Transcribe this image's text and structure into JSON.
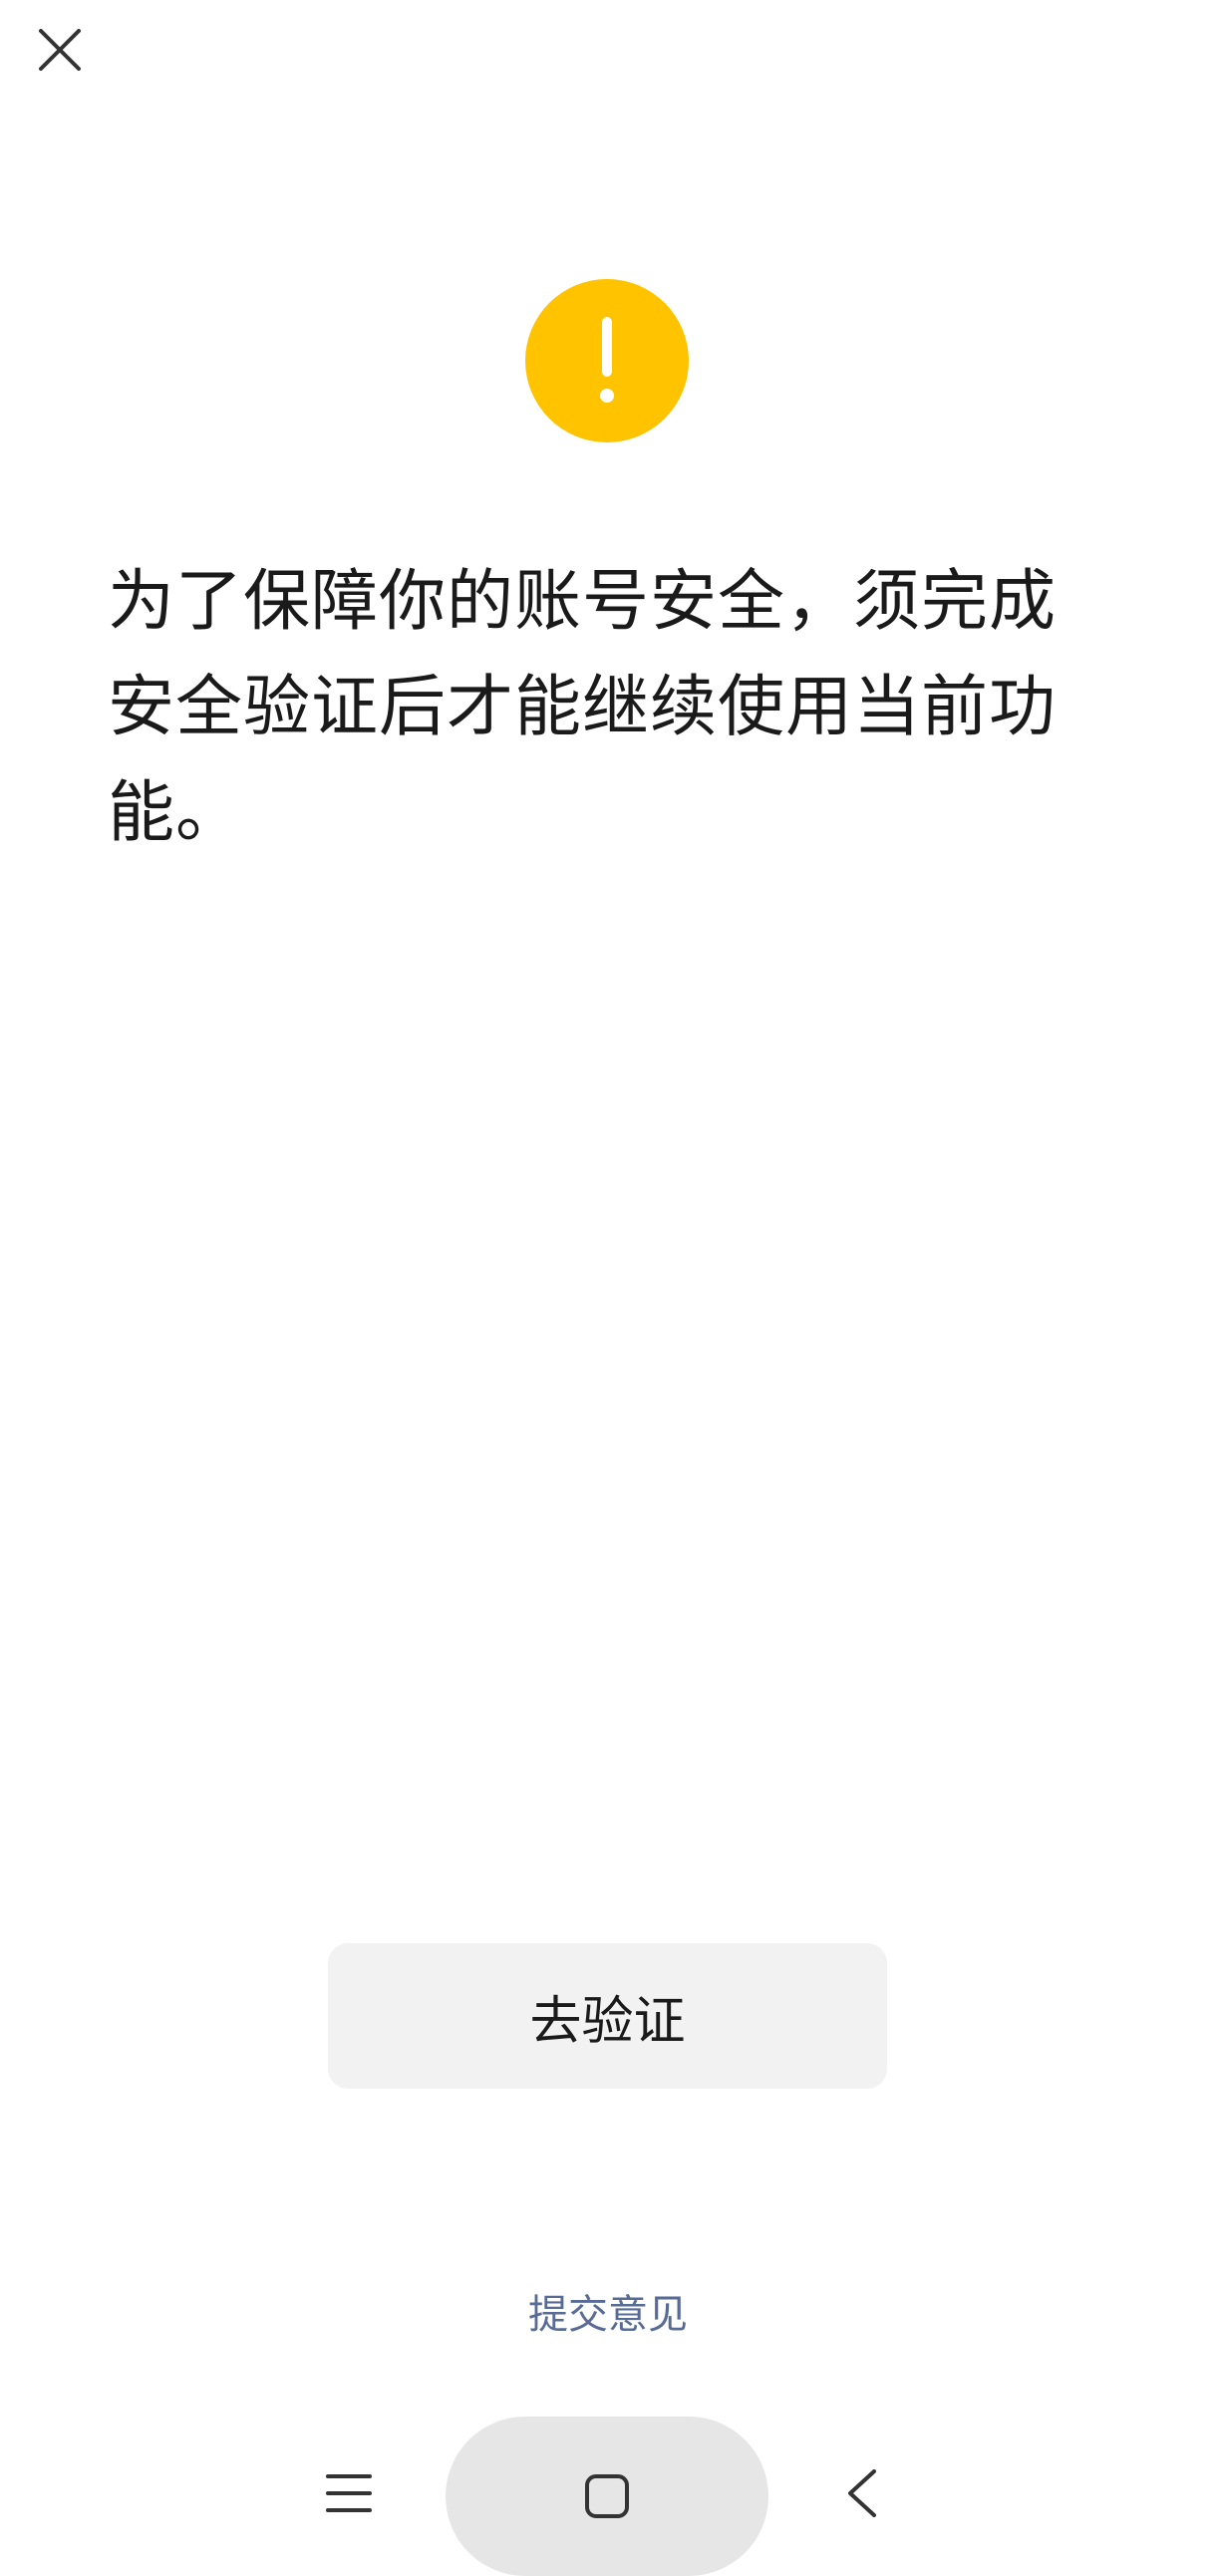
{
  "header": {
    "close_icon": "close-icon"
  },
  "warning": {
    "icon": "exclamation-circle-icon",
    "color": "#FFC300"
  },
  "main": {
    "message": "为了保障你的账号安全，须完成安全验证后才能继续使用当前功能。"
  },
  "actions": {
    "verify_label": "去验证",
    "feedback_label": "提交意见",
    "feedback_color": "#576B95"
  },
  "system_nav": {
    "menu_icon": "menu-icon",
    "home_icon": "home-square-icon",
    "back_icon": "chevron-left-icon"
  }
}
